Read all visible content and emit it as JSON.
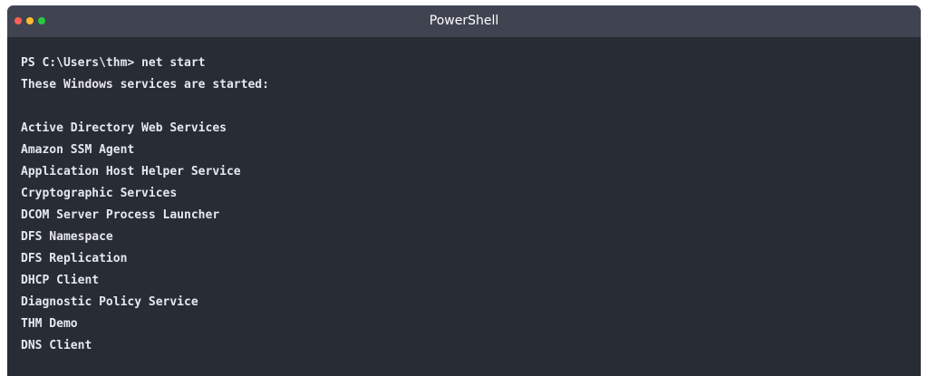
{
  "window": {
    "title": "PowerShell",
    "bg_color": "#272c35",
    "titlebar_color": "#3f4450",
    "text_color": "#e6e8ec",
    "controls": {
      "close_color": "#ff5f57",
      "minimize_color": "#febc2e",
      "maximize_color": "#28c840"
    }
  },
  "terminal": {
    "prompt_line": "PS C:\\Users\\thm> net start",
    "header_line": "These Windows services are started:",
    "services": [
      "Active Directory Web Services",
      "Amazon SSM Agent",
      "Application Host Helper Service",
      "Cryptographic Services",
      "DCOM Server Process Launcher",
      "DFS Namespace",
      "DFS Replication",
      "DHCP Client",
      "Diagnostic Policy Service",
      "THM Demo",
      "DNS Client"
    ]
  }
}
